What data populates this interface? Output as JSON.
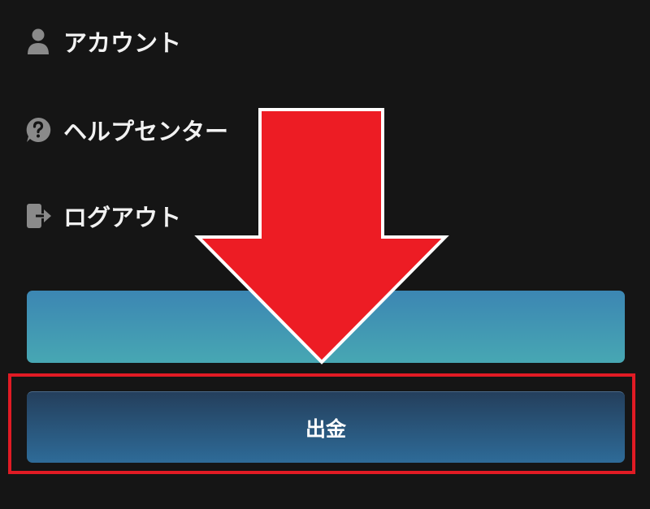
{
  "menu": {
    "items": [
      {
        "label": "アカウント",
        "icon": "user-icon"
      },
      {
        "label": "ヘルプセンター",
        "icon": "help-bubble-icon"
      },
      {
        "label": "ログアウト",
        "icon": "logout-icon"
      }
    ]
  },
  "buttons": {
    "deposit_label": "",
    "withdraw_label": "出金"
  },
  "annotation": {
    "arrow_color": "#ed1c24",
    "highlight_color": "#e01b24"
  },
  "colors": {
    "background": "#151515",
    "text": "#f2f2f2",
    "icon": "#8a8a8a"
  }
}
